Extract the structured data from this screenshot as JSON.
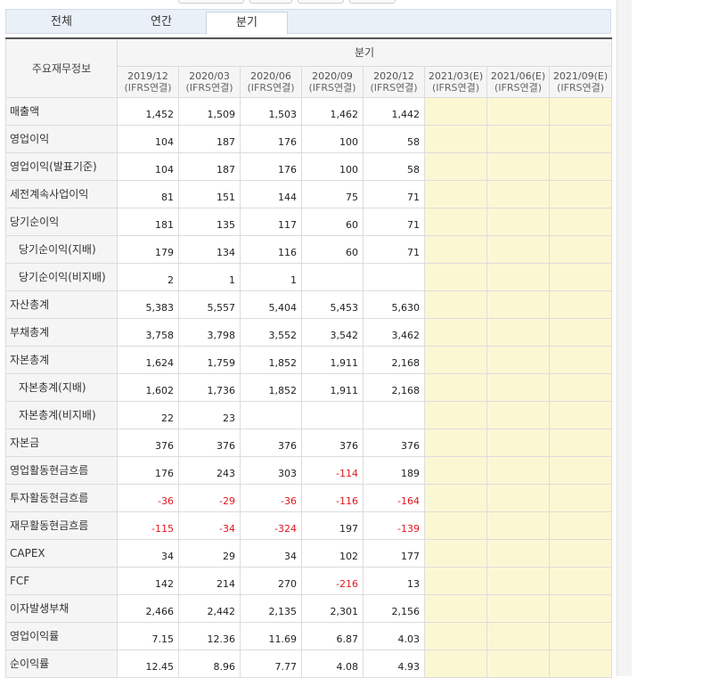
{
  "tabs": [
    {
      "label": "전체"
    },
    {
      "label": "연간"
    },
    {
      "label": "분기"
    }
  ],
  "active_tab": "분기",
  "table": {
    "label_header": "주요재무정보",
    "group_header": "분기",
    "columns": [
      {
        "period": "2019/12",
        "basis": "(IFRS연결)"
      },
      {
        "period": "2020/03",
        "basis": "(IFRS연결)"
      },
      {
        "period": "2020/06",
        "basis": "(IFRS연결)"
      },
      {
        "period": "2020/09",
        "basis": "(IFRS연결)"
      },
      {
        "period": "2020/12",
        "basis": "(IFRS연결)"
      },
      {
        "period": "2021/03(E)",
        "basis": "(IFRS연결)"
      },
      {
        "period": "2021/06(E)",
        "basis": "(IFRS연결)"
      },
      {
        "period": "2021/09(E)",
        "basis": "(IFRS연결)"
      }
    ],
    "rows": [
      {
        "label": "매출액",
        "indent": false,
        "values": [
          "1,452",
          "1,509",
          "1,503",
          "1,462",
          "1,442",
          "",
          "",
          ""
        ]
      },
      {
        "label": "영업이익",
        "indent": false,
        "values": [
          "104",
          "187",
          "176",
          "100",
          "58",
          "",
          "",
          ""
        ]
      },
      {
        "label": "영업이익(발표기준)",
        "indent": false,
        "values": [
          "104",
          "187",
          "176",
          "100",
          "58",
          "",
          "",
          ""
        ]
      },
      {
        "label": "세전계속사업이익",
        "indent": false,
        "values": [
          "81",
          "151",
          "144",
          "75",
          "71",
          "",
          "",
          ""
        ]
      },
      {
        "label": "당기순이익",
        "indent": false,
        "values": [
          "181",
          "135",
          "117",
          "60",
          "71",
          "",
          "",
          ""
        ]
      },
      {
        "label": "당기순이익(지배)",
        "indent": true,
        "values": [
          "179",
          "134",
          "116",
          "60",
          "71",
          "",
          "",
          ""
        ]
      },
      {
        "label": "당기순이익(비지배)",
        "indent": true,
        "values": [
          "2",
          "1",
          "1",
          "",
          "",
          "",
          "",
          ""
        ]
      },
      {
        "label": "자산총계",
        "indent": false,
        "values": [
          "5,383",
          "5,557",
          "5,404",
          "5,453",
          "5,630",
          "",
          "",
          ""
        ]
      },
      {
        "label": "부채총계",
        "indent": false,
        "values": [
          "3,758",
          "3,798",
          "3,552",
          "3,542",
          "3,462",
          "",
          "",
          ""
        ]
      },
      {
        "label": "자본총계",
        "indent": false,
        "values": [
          "1,624",
          "1,759",
          "1,852",
          "1,911",
          "2,168",
          "",
          "",
          ""
        ]
      },
      {
        "label": "자본총계(지배)",
        "indent": true,
        "values": [
          "1,602",
          "1,736",
          "1,852",
          "1,911",
          "2,168",
          "",
          "",
          ""
        ]
      },
      {
        "label": "자본총계(비지배)",
        "indent": true,
        "values": [
          "22",
          "23",
          "",
          "",
          "",
          "",
          "",
          ""
        ]
      },
      {
        "label": "자본금",
        "indent": false,
        "values": [
          "376",
          "376",
          "376",
          "376",
          "376",
          "",
          "",
          ""
        ]
      },
      {
        "label": "영업활동현금흐름",
        "indent": false,
        "values": [
          "176",
          "243",
          "303",
          "-114",
          "189",
          "",
          "",
          ""
        ]
      },
      {
        "label": "투자활동현금흐름",
        "indent": false,
        "values": [
          "-36",
          "-29",
          "-36",
          "-116",
          "-164",
          "",
          "",
          ""
        ]
      },
      {
        "label": "재무활동현금흐름",
        "indent": false,
        "values": [
          "-115",
          "-34",
          "-324",
          "197",
          "-139",
          "",
          "",
          ""
        ]
      },
      {
        "label": "CAPEX",
        "indent": false,
        "values": [
          "34",
          "29",
          "34",
          "102",
          "177",
          "",
          "",
          ""
        ]
      },
      {
        "label": "FCF",
        "indent": false,
        "values": [
          "142",
          "214",
          "270",
          "-216",
          "13",
          "",
          "",
          ""
        ]
      },
      {
        "label": "이자발생부채",
        "indent": false,
        "values": [
          "2,466",
          "2,442",
          "2,135",
          "2,301",
          "2,156",
          "",
          "",
          ""
        ]
      },
      {
        "label": "영업이익률",
        "indent": false,
        "values": [
          "7.15",
          "12.36",
          "11.69",
          "6.87",
          "4.03",
          "",
          "",
          ""
        ]
      },
      {
        "label": "순이익률",
        "indent": false,
        "values": [
          "12.45",
          "8.96",
          "7.77",
          "4.08",
          "4.93",
          "",
          "",
          ""
        ]
      }
    ]
  },
  "colors": {
    "negative": "#e0171e",
    "estimate_bg": "#fcf7d3",
    "header_bg": "#f5f5f5",
    "tab_bar_bg": "#eaf0f8"
  }
}
